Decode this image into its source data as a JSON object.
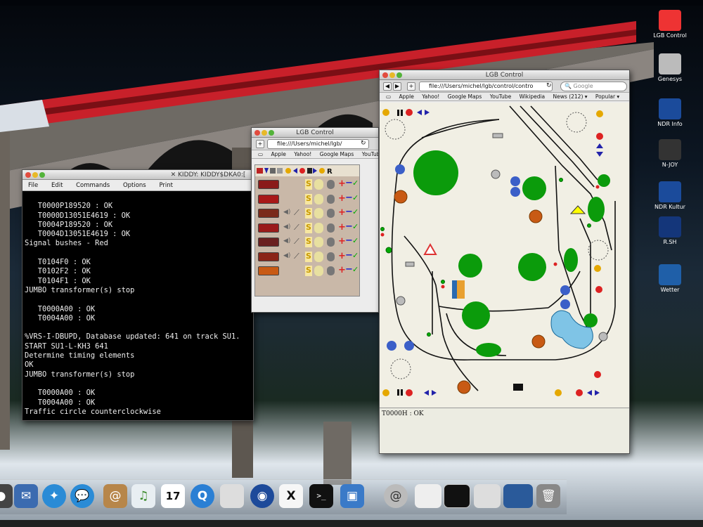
{
  "desktop_icons": [
    {
      "label": "LGB Control",
      "icon": "lgb-icon",
      "color": "#e33"
    },
    {
      "label": "Genesys",
      "icon": "hard-drive-icon",
      "color": "#bbb"
    },
    {
      "label": "NDR Info",
      "icon": "ndr-info-icon",
      "color": "#1b4b9b"
    },
    {
      "label": "N-JOY",
      "icon": "njoy-icon",
      "color": "#333"
    },
    {
      "label": "NDR Kultur",
      "icon": "ndr-kultur-icon",
      "color": "#1b4b9b"
    },
    {
      "label": "R.SH",
      "icon": "rsh-icon",
      "color": "#14367a"
    },
    {
      "label": "Wetter",
      "icon": "weather-icon",
      "color": "#1f5fa8"
    }
  ],
  "terminal": {
    "title": "KIDDY: KIDDY$DKA0:[",
    "menu": [
      "File",
      "Edit",
      "Commands",
      "Options",
      "Print"
    ],
    "lines": [
      "",
      "   T0000P189520 : OK",
      "   T0000D13051E4619 : OK",
      "   T0004P189520 : OK",
      "   T0004D13051E4619 : OK",
      "Signal bushes - Red",
      "",
      "   T0104F0 : OK",
      "   T0102F2 : OK",
      "   T0104F1 : OK",
      "JUMBO transformer(s) stop",
      "",
      "   T0000A00 : OK",
      "   T0004A00 : OK",
      "",
      "%VRS-I-DBUPD, Database updated: 641 on track SU1.",
      "START SU1-L-KH3 641",
      "Determine timing elements",
      "OK",
      "JUMBO transformer(s) stop",
      "",
      "   T0000A00 : OK",
      "   T0004A00 : OK",
      "Traffic circle counterclockwise"
    ]
  },
  "small_browser": {
    "title": "LGB Control",
    "url": "file:///Users/michel/lgb/",
    "bookmarks": [
      "Apple",
      "Yahoo!",
      "Google Maps",
      "YouTube"
    ],
    "loco_symbol": "S"
  },
  "big_browser": {
    "title": "LGB Control",
    "url": "file:///Users/michel/lgb/control/contro",
    "search_placeholder": "Google",
    "bookmarks": [
      "Apple",
      "Yahoo!",
      "Google Maps",
      "YouTube",
      "Wikipedia",
      "News (212) ▾",
      "Popular ▾"
    ],
    "status": "T0000H : OK"
  },
  "dock": {
    "calendar_day": "17"
  }
}
